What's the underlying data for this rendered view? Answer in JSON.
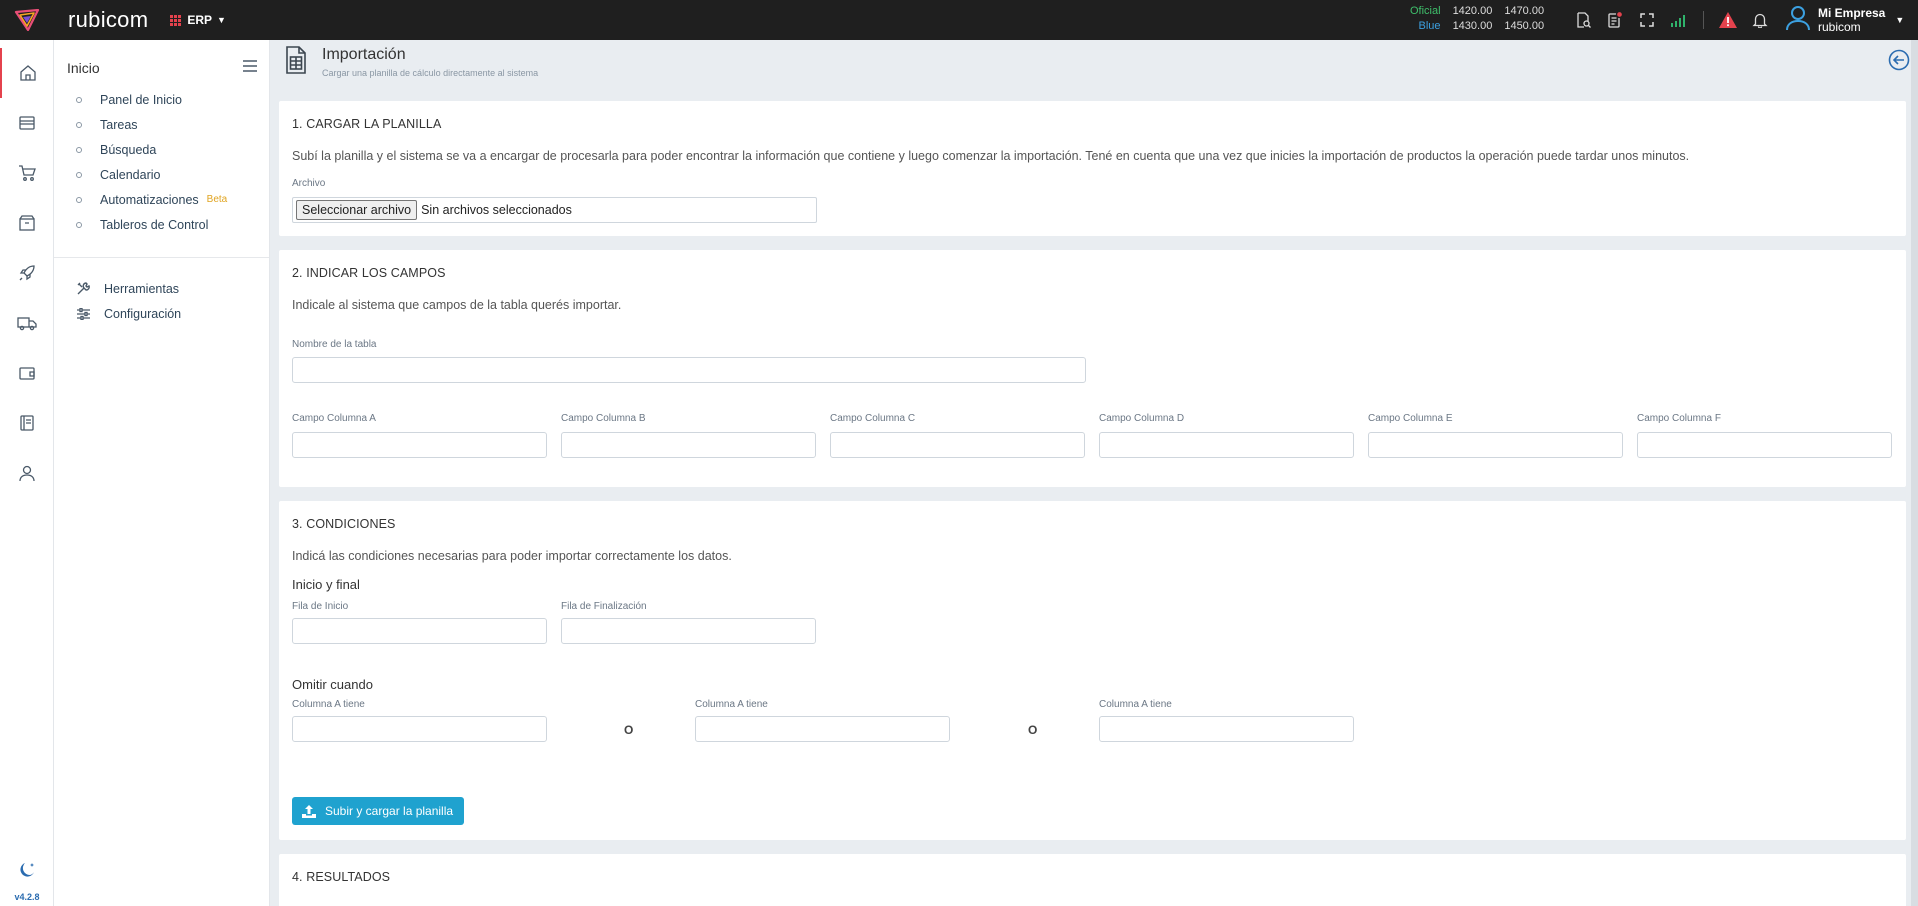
{
  "app": {
    "brand": "rubicom",
    "module": "ERP",
    "version": "v4.2.8"
  },
  "rates": {
    "oficial": {
      "label": "Oficial",
      "buy": "1420.00",
      "sell": "1470.00"
    },
    "blue": {
      "label": "Blue",
      "buy": "1430.00",
      "sell": "1450.00"
    }
  },
  "user": {
    "company": "Mi Empresa",
    "name": "rubicom"
  },
  "rail_icons": [
    "home-icon",
    "store-icon",
    "cart-icon",
    "box-icon",
    "rocket-icon",
    "truck-icon",
    "wallet-icon",
    "book-icon",
    "user-icon"
  ],
  "sidebar": {
    "title": "Inicio",
    "items": [
      {
        "label": "Panel de Inicio"
      },
      {
        "label": "Tareas"
      },
      {
        "label": "Búsqueda"
      },
      {
        "label": "Calendario"
      },
      {
        "label": "Automatizaciones",
        "badge": "Beta"
      },
      {
        "label": "Tableros de Control"
      }
    ],
    "tools": [
      {
        "label": "Herramientas",
        "icon": "tools-icon"
      },
      {
        "label": "Configuración",
        "icon": "sliders-icon"
      }
    ]
  },
  "page": {
    "title": "Importación",
    "subtitle": "Cargar una planilla de cálculo directamente al sistema"
  },
  "step1": {
    "title": "1. CARGAR LA PLANILLA",
    "desc": "Subí la planilla y el sistema se va a encargar de procesarla para poder encontrar la información que contiene y luego comenzar la importación. Tené en cuenta que una vez que inicies la importación de productos la operación puede tardar unos minutos.",
    "file_label": "Archivo",
    "file_button": "Seleccionar archivo",
    "file_status": "Sin archivos seleccionados"
  },
  "step2": {
    "title": "2. INDICAR LOS CAMPOS",
    "desc": "Indicale al sistema que campos de la tabla querés importar.",
    "table_label": "Nombre de la tabla",
    "columns": [
      "Campo Columna A",
      "Campo Columna B",
      "Campo Columna C",
      "Campo Columna D",
      "Campo Columna E",
      "Campo Columna F"
    ]
  },
  "step3": {
    "title": "3. CONDICIONES",
    "desc": "Indicá las condiciones necesarias para poder importar correctamente los datos.",
    "range_title": "Inicio y final",
    "start_label": "Fila de Inicio",
    "end_label": "Fila de Finalización",
    "omit_title": "Omitir cuando",
    "omit_labels": [
      "Columna A tiene",
      "Columna A tiene",
      "Columna A tiene"
    ],
    "or": "O",
    "upload_button": "Subir y cargar la planilla"
  },
  "step4": {
    "title": "4. RESULTADOS"
  }
}
